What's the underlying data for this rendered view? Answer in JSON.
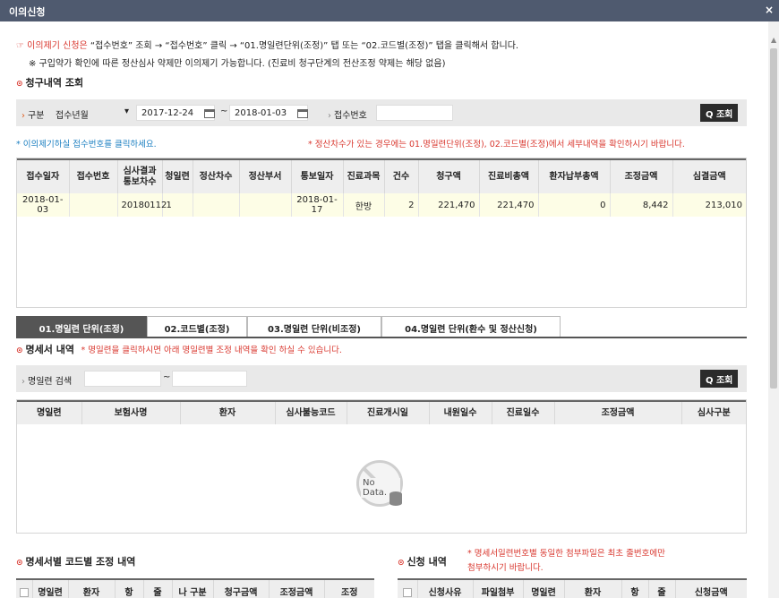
{
  "window": {
    "title": "이의신청",
    "close": "×"
  },
  "notice": {
    "icon": "☞",
    "lead": "이의제기 신청은",
    "text": " “접수번호” 조회 → “접수번호” 클릭 → “01.명일련단위(조정)” 탭 또는 “02.코드별(조정)” 탭을 클릭해서 합니다.",
    "note": "※ 구입약가 확인에 따른 정산심사 약제만 이의제기 가능합니다. (진료비 청구단계의 전산조정 약제는 해당 없음)"
  },
  "claim_section": {
    "bullet": "⊙",
    "title": "청구내역 조회"
  },
  "claim_search": {
    "type_label": "구분",
    "type_value": "접수년월",
    "type_dropdown": "▾",
    "date_from": "2017-12-24",
    "tilde": "~",
    "date_to": "2018-01-03",
    "receipt_label": "접수번호",
    "receipt_value": "",
    "search_button": "Q 조회"
  },
  "info": {
    "left": "* 이의제기하실 접수번호를 클릭하세요.",
    "right": "* 정산차수가 있는 경우에는 01.명일련단위(조정), 02.코드별(조정)에서 세부내역을 확인하시기 바랍니다."
  },
  "claim_table": {
    "headers": [
      "접수일자",
      "접수번호",
      "심사결과 통보차수",
      "청일련",
      "정산차수",
      "정산부서",
      "통보일자",
      "진료과목",
      "건수",
      "청구액",
      "진료비총액",
      "환자납부총액",
      "조정금액",
      "심결금액"
    ],
    "rows": [
      [
        "2018-01-03",
        "",
        "20180112",
        "1",
        "",
        "",
        "2018-01-17",
        "한방",
        "2",
        "221,470",
        "221,470",
        "0",
        "8,442",
        "213,010"
      ]
    ]
  },
  "tabs": [
    {
      "label": "01.명일련 단위(조정)",
      "active": true
    },
    {
      "label": "02.코드별(조정)",
      "active": false
    },
    {
      "label": "03.명일련 단위(비조정)",
      "active": false
    },
    {
      "label": "04.명일련 단위(환수 및 정산신청)",
      "active": false
    }
  ],
  "statement_section": {
    "bullet": "⊙",
    "title": "명세서 내역",
    "hint": "* 명일련을 클릭하시면 아래 명일련별 조정 내역을 확인 하실 수 있습니다."
  },
  "statement_search": {
    "label": "명일련 검색",
    "from": "",
    "tilde": "~",
    "to": "",
    "search_button": "Q 조회"
  },
  "statement_table": {
    "headers": [
      "명일련",
      "보험사명",
      "환자",
      "심사불능코드",
      "진료개시일",
      "내원일수",
      "진료일수",
      "조정금액",
      "심사구분"
    ]
  },
  "no_data": "No Data.",
  "code_adjust": {
    "bullet": "⊙",
    "title": "명세서별 코드별 조정 내역",
    "headers": [
      "명일련",
      "환자",
      "항",
      "줄",
      "나 구분",
      "청구금액",
      "조정금액",
      "조정"
    ]
  },
  "apply": {
    "bullet": "⊙",
    "title": "신청 내역",
    "note1": "* 명세서일련번호별 동일한 첨부파일은 최초 줄번호에만",
    "note2": "첨부하시기 바랍니다.",
    "headers": [
      "신청사유",
      "파일첨부",
      "명일련",
      "환자",
      "항",
      "줄",
      "신청금액"
    ]
  }
}
